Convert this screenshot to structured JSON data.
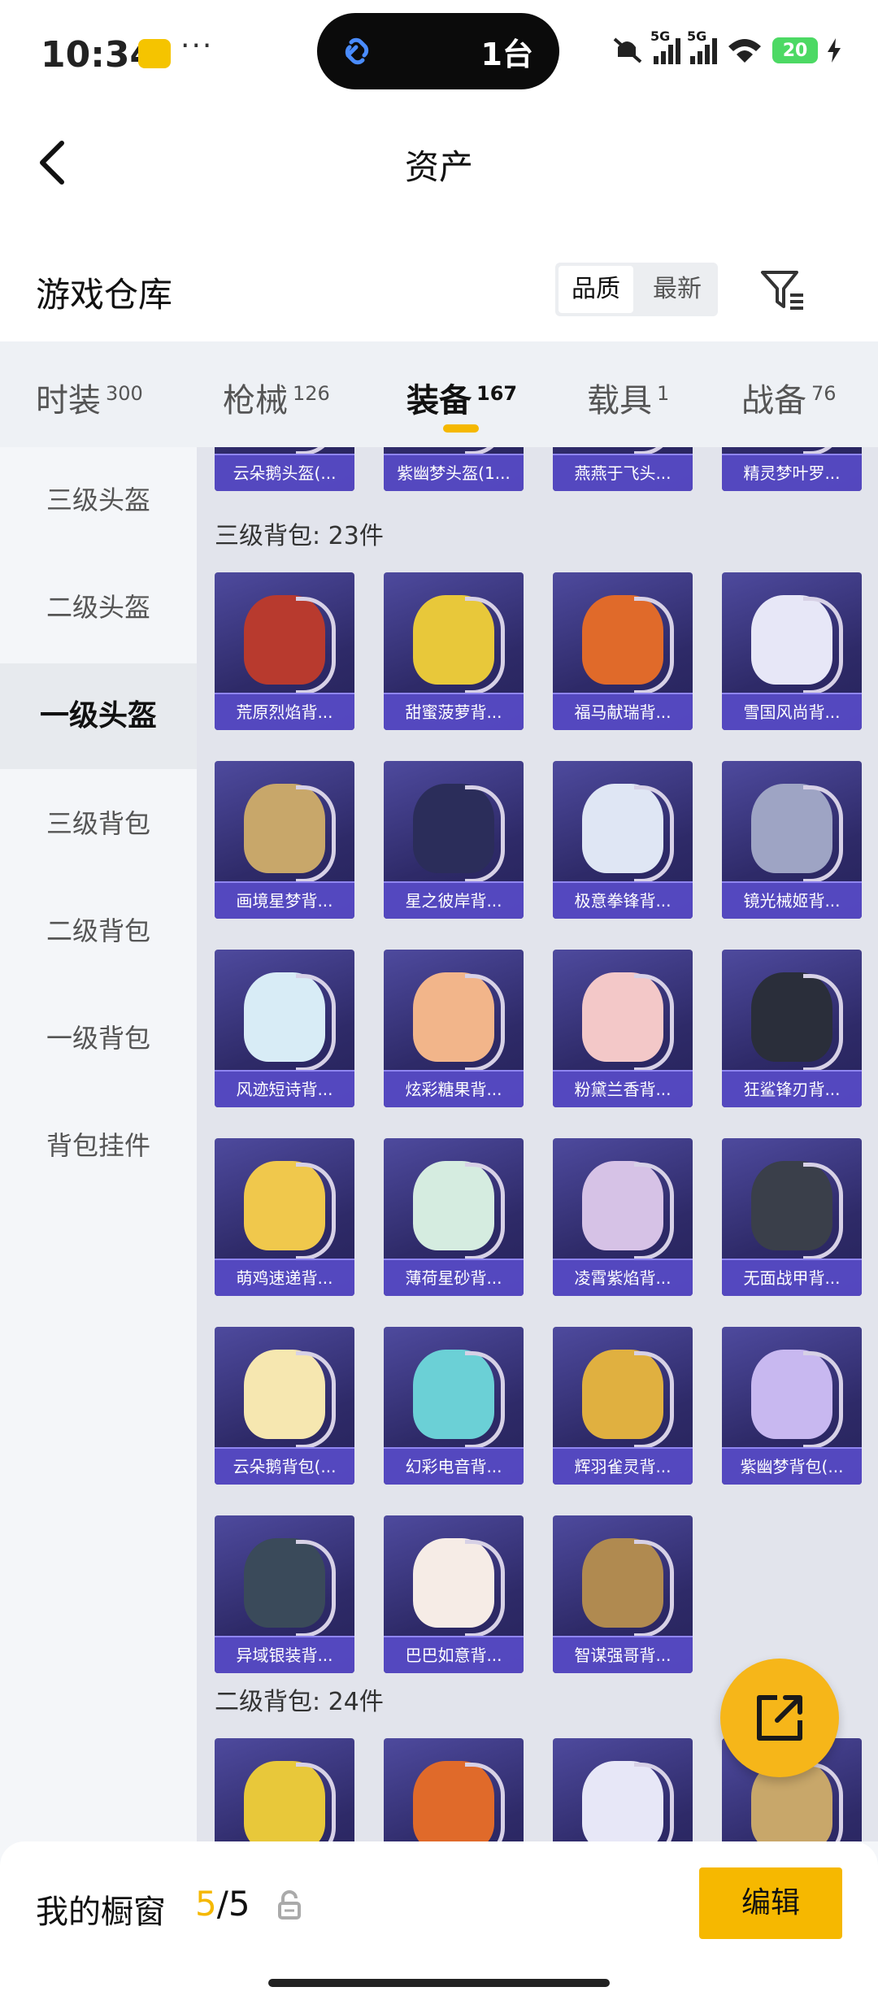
{
  "status_bar": {
    "time": "10:34",
    "island_text": "1台",
    "battery": "20",
    "signal_label": "5G"
  },
  "header": {
    "title": "资产"
  },
  "section": {
    "title": "游戏仓库",
    "sort_options": [
      "品质",
      "最新"
    ]
  },
  "tabs": [
    {
      "label": "时装",
      "count": "300"
    },
    {
      "label": "枪械",
      "count": "126"
    },
    {
      "label": "装备",
      "count": "167"
    },
    {
      "label": "载具",
      "count": "1"
    },
    {
      "label": "战备",
      "count": "76"
    }
  ],
  "sidebar": {
    "items": [
      "三级头盔",
      "二级头盔",
      "一级头盔",
      "三级背包",
      "二级背包",
      "一级背包",
      "背包挂件"
    ],
    "active_index": 2
  },
  "top_partial_row": [
    "云朵鹅头盔(...",
    "紫幽梦头盔(1...",
    "燕燕于飞头...",
    "精灵梦叶罗..."
  ],
  "groups": [
    {
      "title": "三级背包: 23件",
      "items": [
        "荒原烈焰背...",
        "甜蜜菠萝背...",
        "福马献瑞背...",
        "雪国风尚背...",
        "画境星梦背...",
        "星之彼岸背...",
        "极意拳锋背...",
        "镜光械姬背...",
        "风迹短诗背...",
        "炫彩糖果背...",
        "粉黛兰香背...",
        "狂鲨锋刃背...",
        "萌鸡速递背...",
        "薄荷星砂背...",
        "凌霄紫焰背...",
        "无面战甲背...",
        "云朵鹅背包(...",
        "幻彩电音背...",
        "辉羽雀灵背...",
        "紫幽梦背包(...",
        "异域银装背...",
        "巴巴如意背...",
        "智谋强哥背..."
      ]
    },
    {
      "title": "二级背包: 24件",
      "items": [
        "",
        "",
        "",
        ""
      ]
    }
  ],
  "bottom_bar": {
    "label": "我的橱窗",
    "current": "5",
    "total": "/5",
    "edit_label": "编辑"
  },
  "colors": {
    "accent": "#f6b800",
    "card_name_bg": "#564ac4",
    "card_bg": "#2e2a68"
  }
}
